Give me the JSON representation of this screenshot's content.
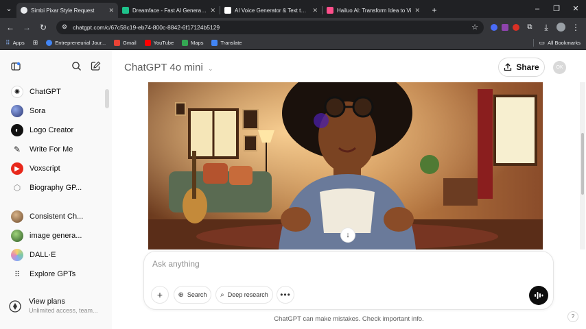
{
  "browser": {
    "tabs": [
      {
        "title": "Simbi Pixar Style Request",
        "favicon_color": "#e8eaed",
        "active": true
      },
      {
        "title": "Dreamface - Fast AI Generator",
        "favicon_color": "#1ec28b",
        "active": false
      },
      {
        "title": "AI Voice Generator & Text to Sp",
        "favicon_color": "#ffffff",
        "active": false
      },
      {
        "title": "Hailuo AI: Transform Idea to Vi",
        "favicon_color": "#ff4f8b",
        "active": false
      }
    ],
    "url": "chatgpt.com/c/67c58c19-eb74-800c-8842-6f17124b5129",
    "bookmarks": [
      {
        "label": "Apps",
        "icon": "grid-icon",
        "color": "#8ab4f8"
      },
      {
        "label": "",
        "icon": "apps-grid-icon",
        "color": "#e8eaed"
      },
      {
        "label": "Entrepreneurial Jour...",
        "icon": "google-icon",
        "color": "#4285f4"
      },
      {
        "label": "Gmail",
        "icon": "gmail-icon",
        "color": "#ea4335"
      },
      {
        "label": "YouTube",
        "icon": "youtube-icon",
        "color": "#ff0000"
      },
      {
        "label": "Maps",
        "icon": "maps-icon",
        "color": "#34a853"
      },
      {
        "label": "Translate",
        "icon": "translate-icon",
        "color": "#4285f4"
      }
    ],
    "all_bookmarks": "All Bookmarks"
  },
  "sidebar": {
    "items": [
      {
        "label": "ChatGPT",
        "icon": "openai-logo-icon",
        "color": "#ffffff"
      },
      {
        "label": "Sora",
        "icon": "sora-icon",
        "color": "#3a4a8a"
      },
      {
        "label": "Logo Creator",
        "icon": "logo-creator-icon",
        "color": "#111111"
      },
      {
        "label": "Write For Me",
        "icon": "pen-icon",
        "color": "#ffffff"
      },
      {
        "label": "Voxscript",
        "icon": "voxscript-icon",
        "color": "#e8281b"
      },
      {
        "label": "Biography GP...",
        "icon": "biography-icon",
        "color": "#ffffff"
      },
      {
        "label": "Consistent Ch...",
        "icon": "consistent-char-icon",
        "color": "#a7845a"
      },
      {
        "label": "image genera...",
        "icon": "image-gen-icon",
        "color": "#4b7a3e"
      },
      {
        "label": "DALL·E",
        "icon": "dalle-icon",
        "color": "#7cc9a6"
      },
      {
        "label": "Explore GPTs",
        "icon": "explore-grid-icon",
        "color": "#ffffff"
      }
    ],
    "view_plans": {
      "title": "View plans",
      "subtitle": "Unlimited access, team..."
    }
  },
  "main": {
    "model_name": "ChatGPT 4o mini",
    "share_label": "Share",
    "avatar_initials": "OK",
    "prompt_placeholder": "Ask anything",
    "buttons": {
      "search": "Search",
      "deep_research": "Deep research"
    },
    "disclaimer": "ChatGPT can make mistakes. Check important info.",
    "help": "?"
  },
  "colors": {
    "sidebar_bg": "#f9f9f9",
    "browser_dark": "#202124",
    "browser_toolbar": "#35363a",
    "voice_button": "#0d0d0d"
  }
}
